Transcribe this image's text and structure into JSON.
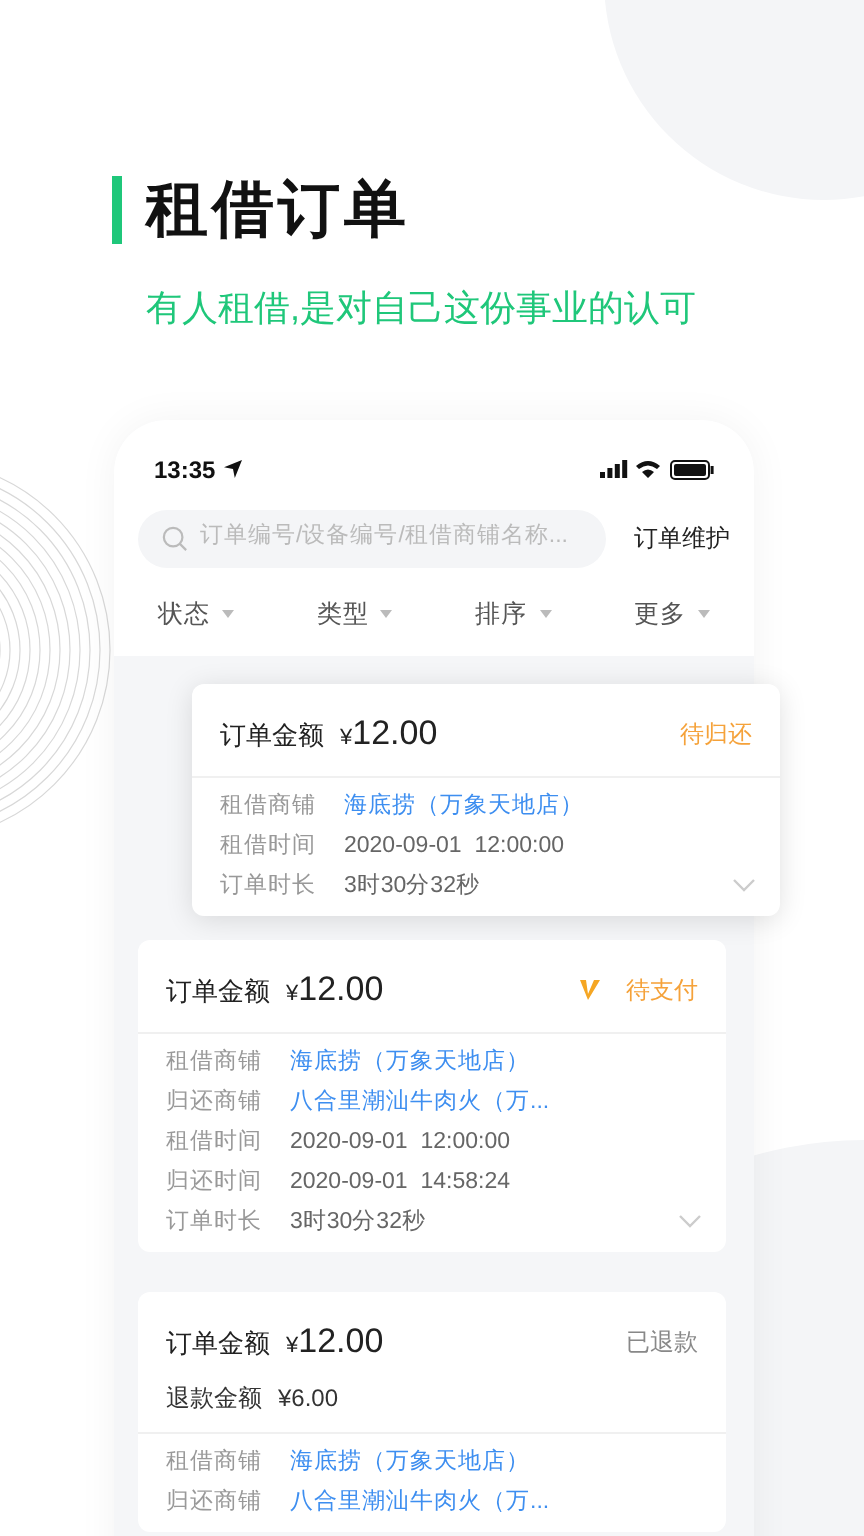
{
  "header": {
    "title": "租借订单",
    "subtitle": "有人租借,是对自己这份事业的认可"
  },
  "status_bar": {
    "time": "13:35"
  },
  "search": {
    "placeholder": "订单编号/设备编号/租借商铺名称...",
    "action": "订单维护"
  },
  "filters": [
    {
      "label": "状态"
    },
    {
      "label": "类型"
    },
    {
      "label": "排序"
    },
    {
      "label": "更多"
    }
  ],
  "orders": [
    {
      "raised": true,
      "amount_label": "订单金额",
      "currency": "¥",
      "amount": "12.00",
      "status": "待归还",
      "kind": "return",
      "expandable": true,
      "rows": [
        {
          "label": "租借商铺",
          "value": "海底捞（万象天地店）",
          "link": true
        },
        {
          "label": "租借时间",
          "value": "2020-09-01  12:00:00",
          "link": false
        },
        {
          "label": "订单时长",
          "value": "3时30分32秒",
          "link": false
        }
      ]
    },
    {
      "raised": false,
      "amount_label": "订单金额",
      "currency": "¥",
      "amount": "12.00",
      "status": "待支付",
      "kind": "pay",
      "expandable": true,
      "rows": [
        {
          "label": "租借商铺",
          "value": "海底捞（万象天地店）",
          "link": true
        },
        {
          "label": "归还商铺",
          "value": "八合里潮汕牛肉火（万...",
          "link": true
        },
        {
          "label": "租借时间",
          "value": "2020-09-01  12:00:00",
          "link": false
        },
        {
          "label": "归还时间",
          "value": "2020-09-01  14:58:24",
          "link": false
        },
        {
          "label": "订单时长",
          "value": "3时30分32秒",
          "link": false
        }
      ]
    },
    {
      "raised": false,
      "amount_label": "订单金额",
      "currency": "¥",
      "amount": "12.00",
      "status": "已退款",
      "kind": "refunded",
      "refund": {
        "label": "退款金额",
        "value": "¥6.00"
      },
      "rows": [
        {
          "label": "租借商铺",
          "value": "海底捞（万象天地店）",
          "link": true
        },
        {
          "label": "归还商铺",
          "value": "八合里潮汕牛肉火（万...",
          "link": true
        }
      ]
    }
  ]
}
